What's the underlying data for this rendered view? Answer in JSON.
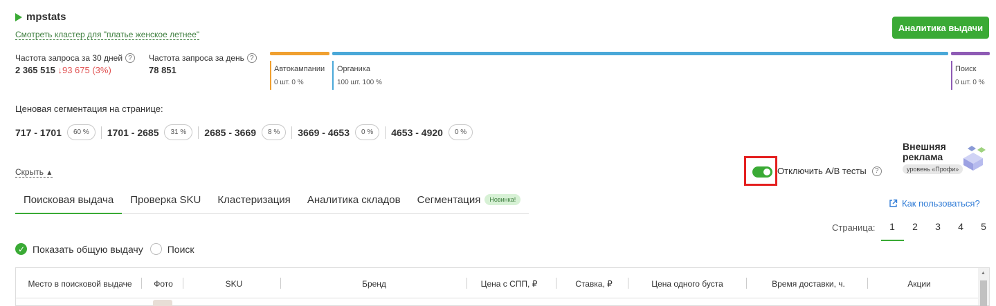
{
  "logo": {
    "text": "mpstats"
  },
  "cluster_link": "Смотреть кластер для \"платье женское летнее\"",
  "analytics_button": "Аналитика выдачи",
  "stats": {
    "freq30_label": "Частота запроса за 30 дней",
    "freq30_value": "2 365 515",
    "freq30_change": "↓93 675 (3%)",
    "freqday_label": "Частота запроса за день",
    "freqday_value": "78 851",
    "help_glyph": "?"
  },
  "segments": [
    {
      "label": "Автокампании",
      "sub": "0 шт. 0 %",
      "color": "#f0a030"
    },
    {
      "label": "Органика",
      "sub": "100 шт. 100 %",
      "color": "#4aa8d8"
    },
    {
      "label": "Поиск",
      "sub": "0 шт. 0 %",
      "color": "#8e5bb5"
    }
  ],
  "price": {
    "title": "Ценовая сегментация на странице:",
    "items": [
      {
        "range": "717 - 1701",
        "pct": "60 %"
      },
      {
        "range": "1701 - 2685",
        "pct": "31 %"
      },
      {
        "range": "2685 - 3669",
        "pct": "8 %"
      },
      {
        "range": "3669 - 4653",
        "pct": "0 %"
      },
      {
        "range": "4653 - 4920",
        "pct": "0 %"
      }
    ]
  },
  "hide_link": "Скрыть",
  "ab_toggle": {
    "label": "Отключить A/B тесты",
    "state": "on"
  },
  "ad_badge": {
    "title_line1": "Внешняя",
    "title_line2": "реклама",
    "level": "уровень «Профи»"
  },
  "tabs": [
    {
      "label": "Поисковая выдача",
      "active": true
    },
    {
      "label": "Проверка SKU"
    },
    {
      "label": "Кластеризация"
    },
    {
      "label": "Аналитика складов"
    },
    {
      "label": "Сегментация",
      "badge": "Новинка!"
    }
  ],
  "howto_link": "Как пользоваться?",
  "pager": {
    "label": "Страница:",
    "pages": [
      "1",
      "2",
      "3",
      "4",
      "5"
    ],
    "current": "1"
  },
  "radio": {
    "option1": "Показать общую выдачу",
    "option2": "Поиск"
  },
  "table": {
    "columns": [
      "Место в поисковой выдаче",
      "Фото",
      "SKU",
      "Бренд",
      "Цена с СПП, ₽",
      "Ставка, ₽",
      "Цена одного буста",
      "Время доставки, ч.",
      "Акции"
    ]
  }
}
